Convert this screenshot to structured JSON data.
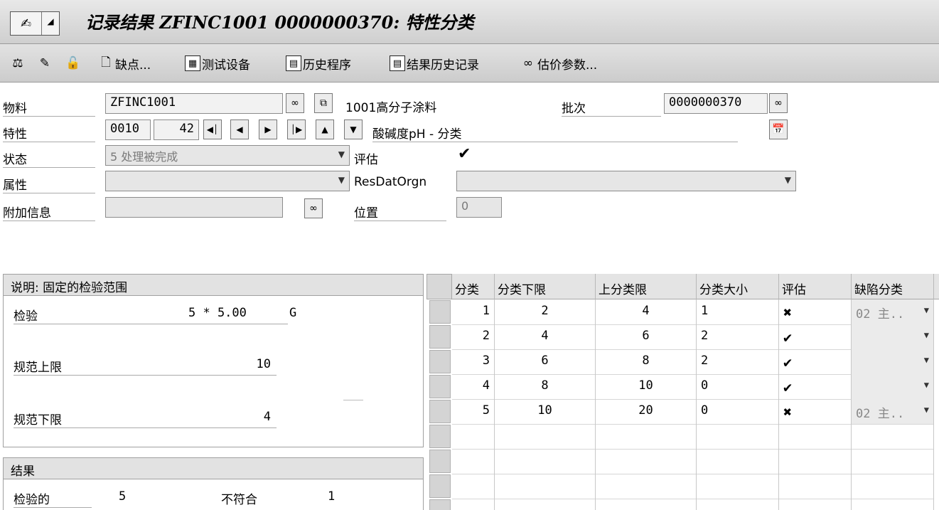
{
  "title": {
    "text": "记录结果 ZFINC1001 0000000370: 特性分类",
    "icon": "edit-note-icon",
    "dropdown_icon": "dropdown-corner-icon"
  },
  "toolbar": {
    "items": [
      {
        "icon": "inspector-icon",
        "label": ""
      },
      {
        "icon": "edit-note-icon",
        "label": ""
      },
      {
        "icon": "unlock-icon",
        "label": ""
      },
      {
        "icon": "document-icon",
        "label": "缺点..."
      },
      {
        "icon": "table-icon",
        "label": "测试设备"
      },
      {
        "icon": "history-icon",
        "label": "历史程序"
      },
      {
        "icon": "monitor-icon",
        "label": "结果历史记录"
      },
      {
        "icon": "glasses-icon",
        "label": "估价参数..."
      }
    ]
  },
  "header": {
    "material_label": "物料",
    "material_value": "ZFINC1001",
    "material_desc": "1001高分子涂料",
    "batch_label": "批次",
    "batch_value": "0000000370",
    "characteristic_label": "特性",
    "char_code": "0010",
    "char_number": "42",
    "char_desc": "酸碱度pH - 分类",
    "status_label": "状态",
    "status_value": "5 处理被完成",
    "valuation_label": "评估",
    "attribute_label": "属性",
    "attribute_value": "",
    "resdatorgn_label": "ResDatOrgn",
    "resdatorgn_value": "",
    "addinfo_label": "附加信息",
    "addinfo_value": "",
    "position_label": "位置",
    "position_value": "0"
  },
  "spec_panel": {
    "title": "说明: 固定的检验范围",
    "inspection_label": "检验",
    "inspection_value": "5 * 5.00",
    "inspection_unit": "G",
    "upper_label": "规范上限",
    "upper_value": "10",
    "lower_label": "规范下限",
    "lower_value": "4"
  },
  "result_panel": {
    "title": "结果",
    "inspected_label": "检验的",
    "inspected_value": "5",
    "nonconforming_label": "不符合",
    "nonconforming_value": "1"
  },
  "grid": {
    "headers": [
      "分类",
      "分类下限",
      "上分类限",
      "分类大小",
      "评估",
      "缺陷分类"
    ],
    "rows": [
      {
        "cls": "1",
        "lower": "2",
        "upper": "4",
        "size": "1",
        "valuation": "reject",
        "defect": "02 主.."
      },
      {
        "cls": "2",
        "lower": "4",
        "upper": "6",
        "size": "2",
        "valuation": "accept",
        "defect": ""
      },
      {
        "cls": "3",
        "lower": "6",
        "upper": "8",
        "size": "2",
        "valuation": "accept",
        "defect": ""
      },
      {
        "cls": "4",
        "lower": "8",
        "upper": "10",
        "size": "0",
        "valuation": "accept",
        "defect": ""
      },
      {
        "cls": "5",
        "lower": "10",
        "upper": "20",
        "size": "0",
        "valuation": "reject",
        "defect": "02 主.."
      }
    ]
  }
}
